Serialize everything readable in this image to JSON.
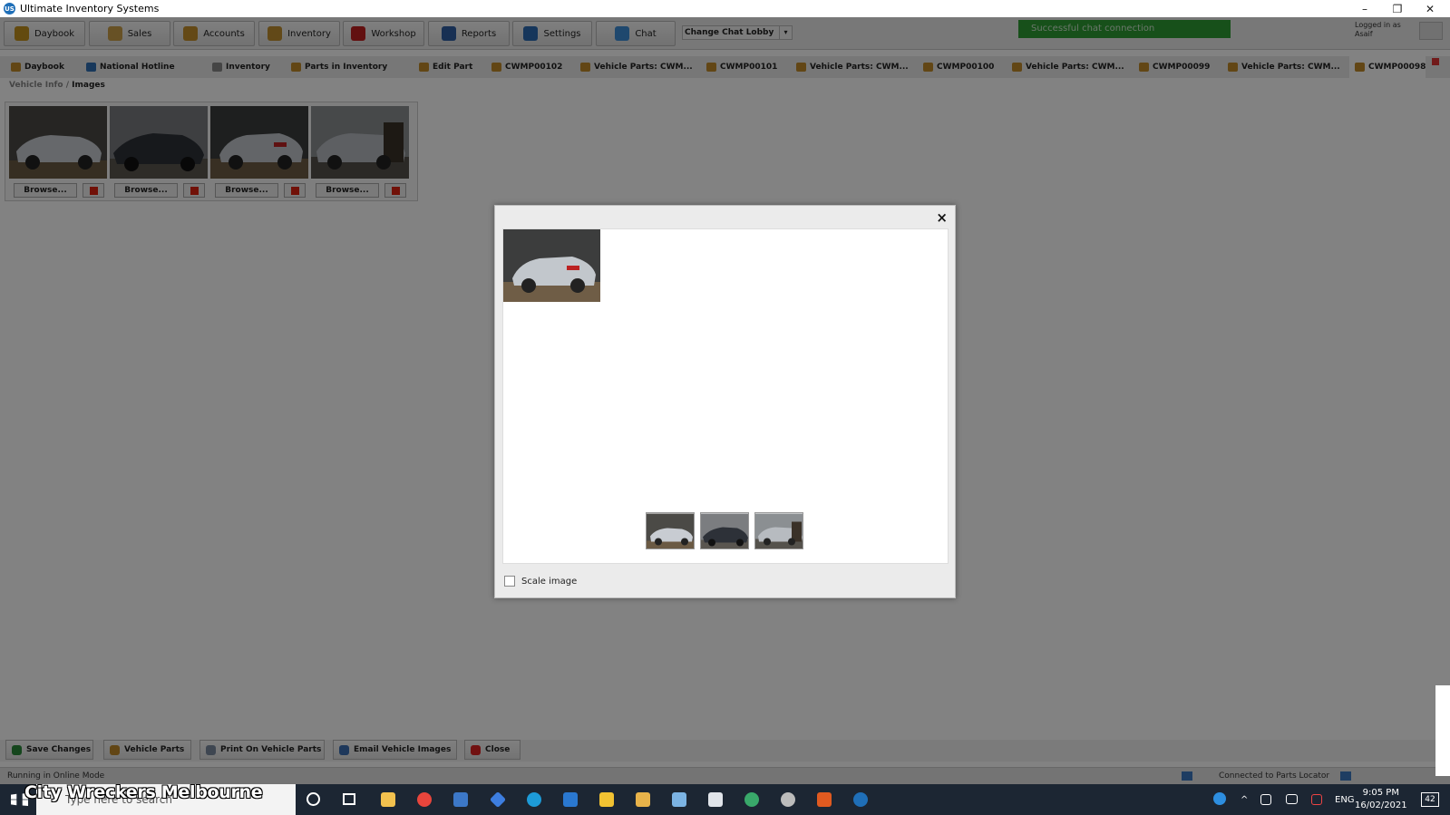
{
  "window": {
    "title": "Ultimate Inventory Systems",
    "icon_text": "US"
  },
  "toolbar": {
    "buttons": [
      {
        "label": "Daybook",
        "icon": "daybook-icon",
        "color": "#c3911f"
      },
      {
        "label": "Sales",
        "icon": "sales-icon",
        "color": "#caa04a"
      },
      {
        "label": "Accounts",
        "icon": "accounts-icon",
        "color": "#c58f2b"
      },
      {
        "label": "Inventory",
        "icon": "inventory-icon",
        "color": "#c09030"
      },
      {
        "label": "Workshop",
        "icon": "workshop-icon",
        "color": "#c02020"
      },
      {
        "label": "Reports",
        "icon": "reports-icon",
        "color": "#2f5fa3"
      },
      {
        "label": "Settings",
        "icon": "settings-icon",
        "color": "#2c6bb3"
      },
      {
        "label": "Chat",
        "icon": "chat-icon",
        "color": "#3d8ed8"
      }
    ],
    "chat_lobby": {
      "value": "Change Chat Lobby"
    },
    "chat_status": "Successful chat connection",
    "logged_in_label": "Logged in as",
    "logged_in_user": "Asaif"
  },
  "tabs": [
    {
      "label": "Daybook"
    },
    {
      "label": "National Hotline"
    },
    {
      "label": "Inventory"
    },
    {
      "label": "Parts in Inventory"
    },
    {
      "label": "Edit Part"
    },
    {
      "label": "CWMP00102"
    },
    {
      "label": "Vehicle Parts: CWM..."
    },
    {
      "label": "CWMP00101"
    },
    {
      "label": "Vehicle Parts: CWM..."
    },
    {
      "label": "CWMP00100"
    },
    {
      "label": "Vehicle Parts: CWM..."
    },
    {
      "label": "CWMP00099"
    },
    {
      "label": "Vehicle Parts: CWM..."
    },
    {
      "label": "CWMP00098"
    }
  ],
  "breadcrumb": {
    "parent": "Vehicle Info",
    "separator": "/",
    "current": "Images"
  },
  "image_slots": [
    {
      "browse_label": "Browse...",
      "car_color": "#c8ccd2"
    },
    {
      "browse_label": "Browse...",
      "car_color": "#2d3138"
    },
    {
      "browse_label": "Browse...",
      "car_color": "#c2c7cc"
    },
    {
      "browse_label": "Browse...",
      "car_color": "#b7bbc0"
    }
  ],
  "bottom_buttons": [
    {
      "label": "Save Changes",
      "icon": "save-icon"
    },
    {
      "label": "Vehicle Parts",
      "icon": "vehicle-parts-icon"
    },
    {
      "label": "Print On Vehicle Parts",
      "icon": "print-icon"
    },
    {
      "label": "Email Vehicle Images",
      "icon": "email-icon"
    },
    {
      "label": "Close",
      "icon": "close-icon"
    }
  ],
  "statusbar": {
    "mode": "Running in Online Mode",
    "parts_locator": "Connected to Parts Locator"
  },
  "dialog": {
    "close_symbol": "×",
    "scale_label": "Scale image",
    "scale_checked": false
  },
  "taskbar": {
    "search_placeholder": "Type here to search",
    "language": "ENG",
    "time": "9:05 PM",
    "date": "16/02/2021",
    "notification_count": "42",
    "watermark": "City Wreckers Melbourne"
  }
}
